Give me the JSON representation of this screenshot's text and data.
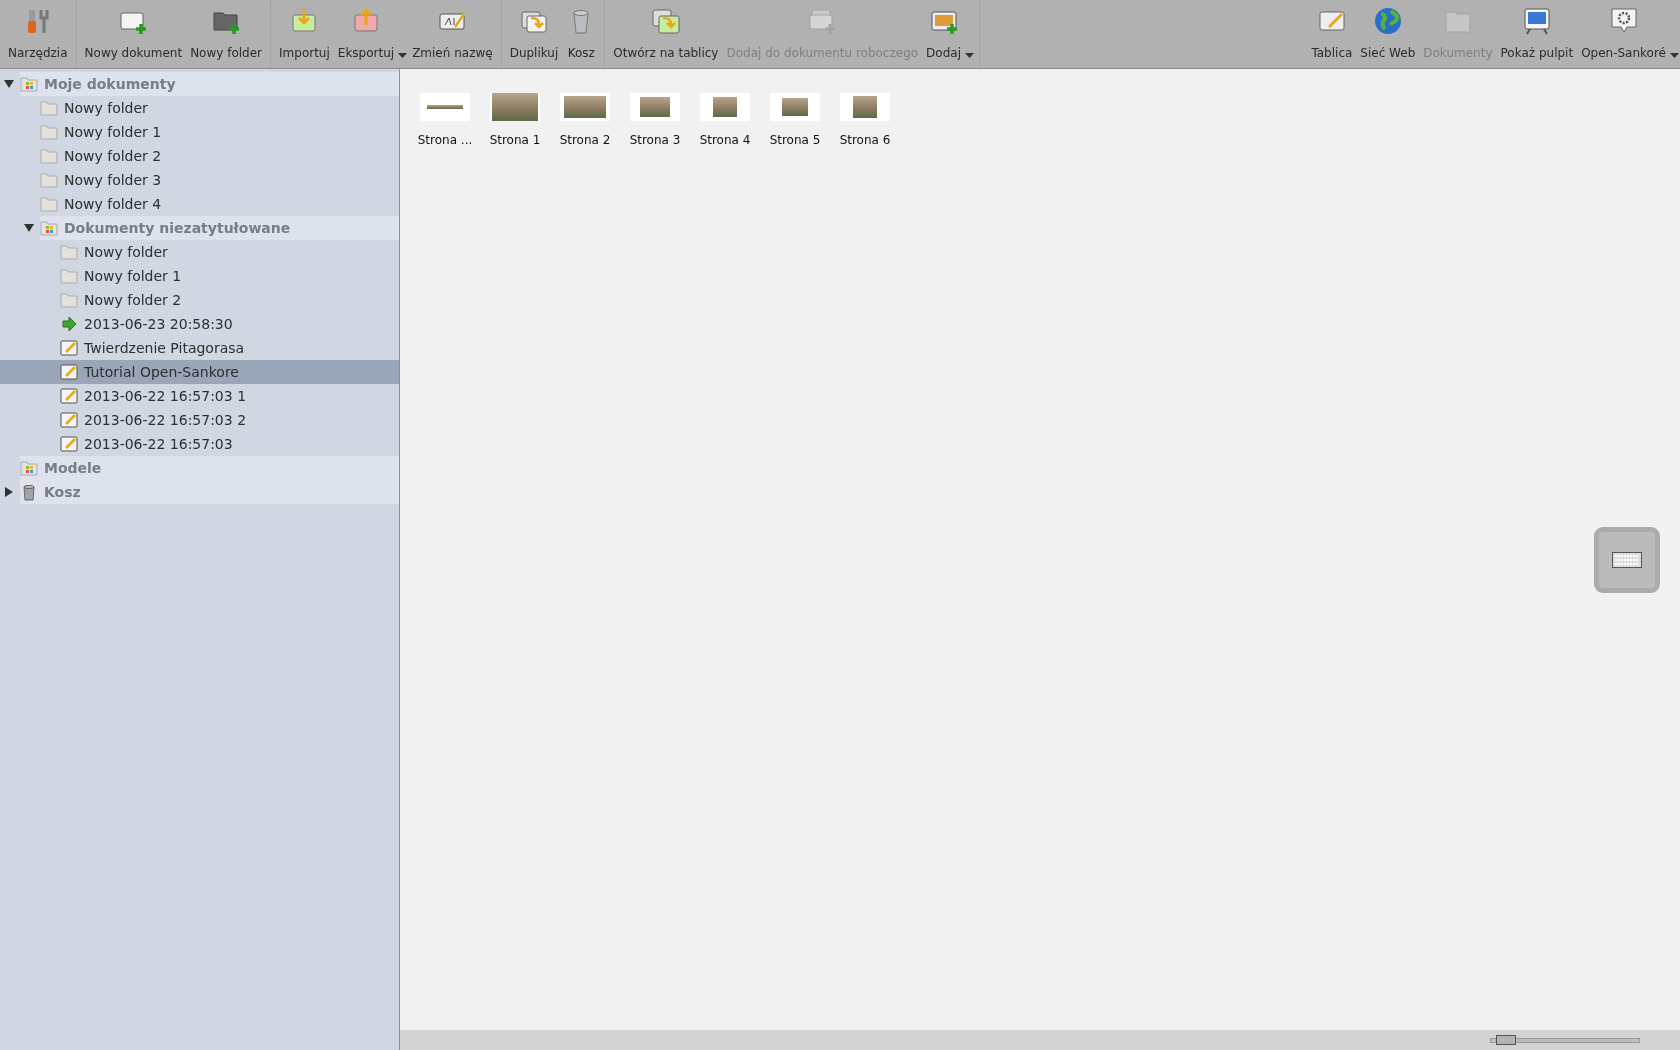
{
  "toolbar": {
    "groups": [
      [
        {
          "label": "Narzędzia",
          "disabled": false,
          "menu": false
        }
      ],
      [
        {
          "label": "Nowy dokument",
          "disabled": false,
          "menu": false
        },
        {
          "label": "Nowy folder",
          "disabled": false,
          "menu": false
        }
      ],
      [
        {
          "label": "Importuj",
          "disabled": false,
          "menu": false
        },
        {
          "label": "Eksportuj",
          "disabled": false,
          "menu": true
        },
        {
          "label": "Zmień nazwę",
          "disabled": false,
          "menu": false
        }
      ],
      [
        {
          "label": "Duplikuj",
          "disabled": false,
          "menu": false
        },
        {
          "label": "Kosz",
          "disabled": false,
          "menu": false
        }
      ],
      [
        {
          "label": "Otwórz na tablicy",
          "disabled": false,
          "menu": false
        },
        {
          "label": "Dodaj do dokumentu roboczego",
          "disabled": true,
          "menu": false
        },
        {
          "label": "Dodaj",
          "disabled": false,
          "menu": true
        }
      ]
    ],
    "right": [
      {
        "label": "Tablica",
        "disabled": false,
        "menu": false
      },
      {
        "label": "Sieć Web",
        "disabled": false,
        "menu": false
      },
      {
        "label": "Dokumenty",
        "disabled": true,
        "menu": false
      },
      {
        "label": "Pokaż pulpit",
        "disabled": false,
        "menu": false
      },
      {
        "label": "Open-Sankoré",
        "disabled": false,
        "menu": true
      }
    ]
  },
  "tree": [
    {
      "label": "Moje dokumenty",
      "kind": "group",
      "expanded": true,
      "selected": false,
      "children": [
        {
          "label": "Nowy folder",
          "kind": "folder",
          "selected": false
        },
        {
          "label": "Nowy folder 1",
          "kind": "folder",
          "selected": false
        },
        {
          "label": "Nowy folder 2",
          "kind": "folder",
          "selected": false
        },
        {
          "label": "Nowy folder 3",
          "kind": "folder",
          "selected": false
        },
        {
          "label": "Nowy folder 4",
          "kind": "folder",
          "selected": false
        },
        {
          "label": "Dokumenty niezatytułowane",
          "kind": "group",
          "expanded": true,
          "selected": false,
          "children": [
            {
              "label": "Nowy folder",
              "kind": "folder",
              "selected": false
            },
            {
              "label": "Nowy folder 1",
              "kind": "folder",
              "selected": false
            },
            {
              "label": "Nowy folder 2",
              "kind": "folder",
              "selected": false
            },
            {
              "label": "2013-06-23 20:58:30",
              "kind": "imported",
              "selected": false
            },
            {
              "label": "Twierdzenie Pitagorasa",
              "kind": "document",
              "selected": false
            },
            {
              "label": "Tutorial Open-Sankore",
              "kind": "document",
              "selected": true
            },
            {
              "label": "2013-06-22 16:57:03 1",
              "kind": "document",
              "selected": false
            },
            {
              "label": "2013-06-22 16:57:03 2",
              "kind": "document",
              "selected": false
            },
            {
              "label": "2013-06-22 16:57:03",
              "kind": "document",
              "selected": false
            }
          ]
        }
      ]
    },
    {
      "label": "Modele",
      "kind": "group",
      "selected": false
    },
    {
      "label": "Kosz",
      "kind": "trash",
      "expanded": false,
      "selected": false
    }
  ],
  "pages": [
    {
      "label": "Strona ..."
    },
    {
      "label": "Strona 1"
    },
    {
      "label": "Strona 2"
    },
    {
      "label": "Strona 3"
    },
    {
      "label": "Strona 4"
    },
    {
      "label": "Strona 5"
    },
    {
      "label": "Strona 6"
    }
  ],
  "zoom_slider": {
    "level": 0.05
  }
}
